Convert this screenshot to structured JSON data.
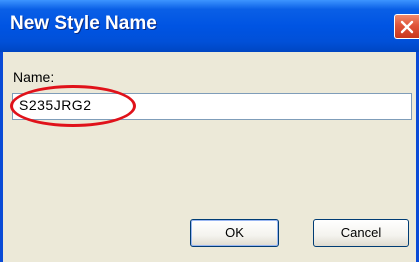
{
  "dialog": {
    "title": "New Style Name",
    "name_label": "Name:",
    "name_value": "S235JRG2",
    "ok_label": "OK",
    "cancel_label": "Cancel",
    "close_icon": "close-icon",
    "highlight_color": "#e0121a",
    "titlebar_color": "#0054e3"
  }
}
